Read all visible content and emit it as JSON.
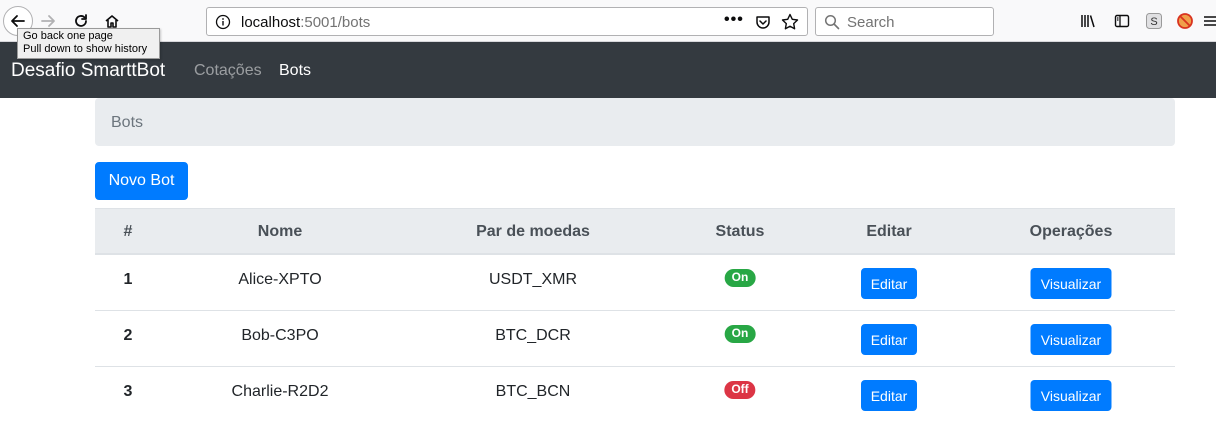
{
  "browser": {
    "url_host": "localhost",
    "url_path": ":5001/bots",
    "url_more": "•••",
    "search_placeholder": "Search",
    "tooltip_line1": "Go back one page",
    "tooltip_line2": "Pull down to show history",
    "s_ext_label": "S"
  },
  "navbar": {
    "brand": "Desafio SmarttBot",
    "links": [
      "Cotações",
      "Bots"
    ],
    "active": "Bots"
  },
  "breadcrumb": {
    "current": "Bots"
  },
  "actions": {
    "new_bot_label": "Novo Bot"
  },
  "table": {
    "headers": [
      "#",
      "Nome",
      "Par de moedas",
      "Status",
      "Editar",
      "Operações"
    ],
    "rows": [
      {
        "id": "1",
        "name": "Alice-XPTO",
        "pair": "USDT_XMR",
        "status": "On",
        "edit_label": "Editar",
        "view_label": "Visualizar"
      },
      {
        "id": "2",
        "name": "Bob-C3PO",
        "pair": "BTC_DCR",
        "status": "On",
        "edit_label": "Editar",
        "view_label": "Visualizar"
      },
      {
        "id": "3",
        "name": "Charlie-R2D2",
        "pair": "BTC_BCN",
        "status": "Off",
        "edit_label": "Editar",
        "view_label": "Visualizar"
      }
    ]
  },
  "colors": {
    "navbar_bg": "#343a40",
    "primary": "#007bff",
    "success": "#28a745",
    "danger": "#dc3545",
    "breadcrumb_bg": "#e9ecef"
  }
}
